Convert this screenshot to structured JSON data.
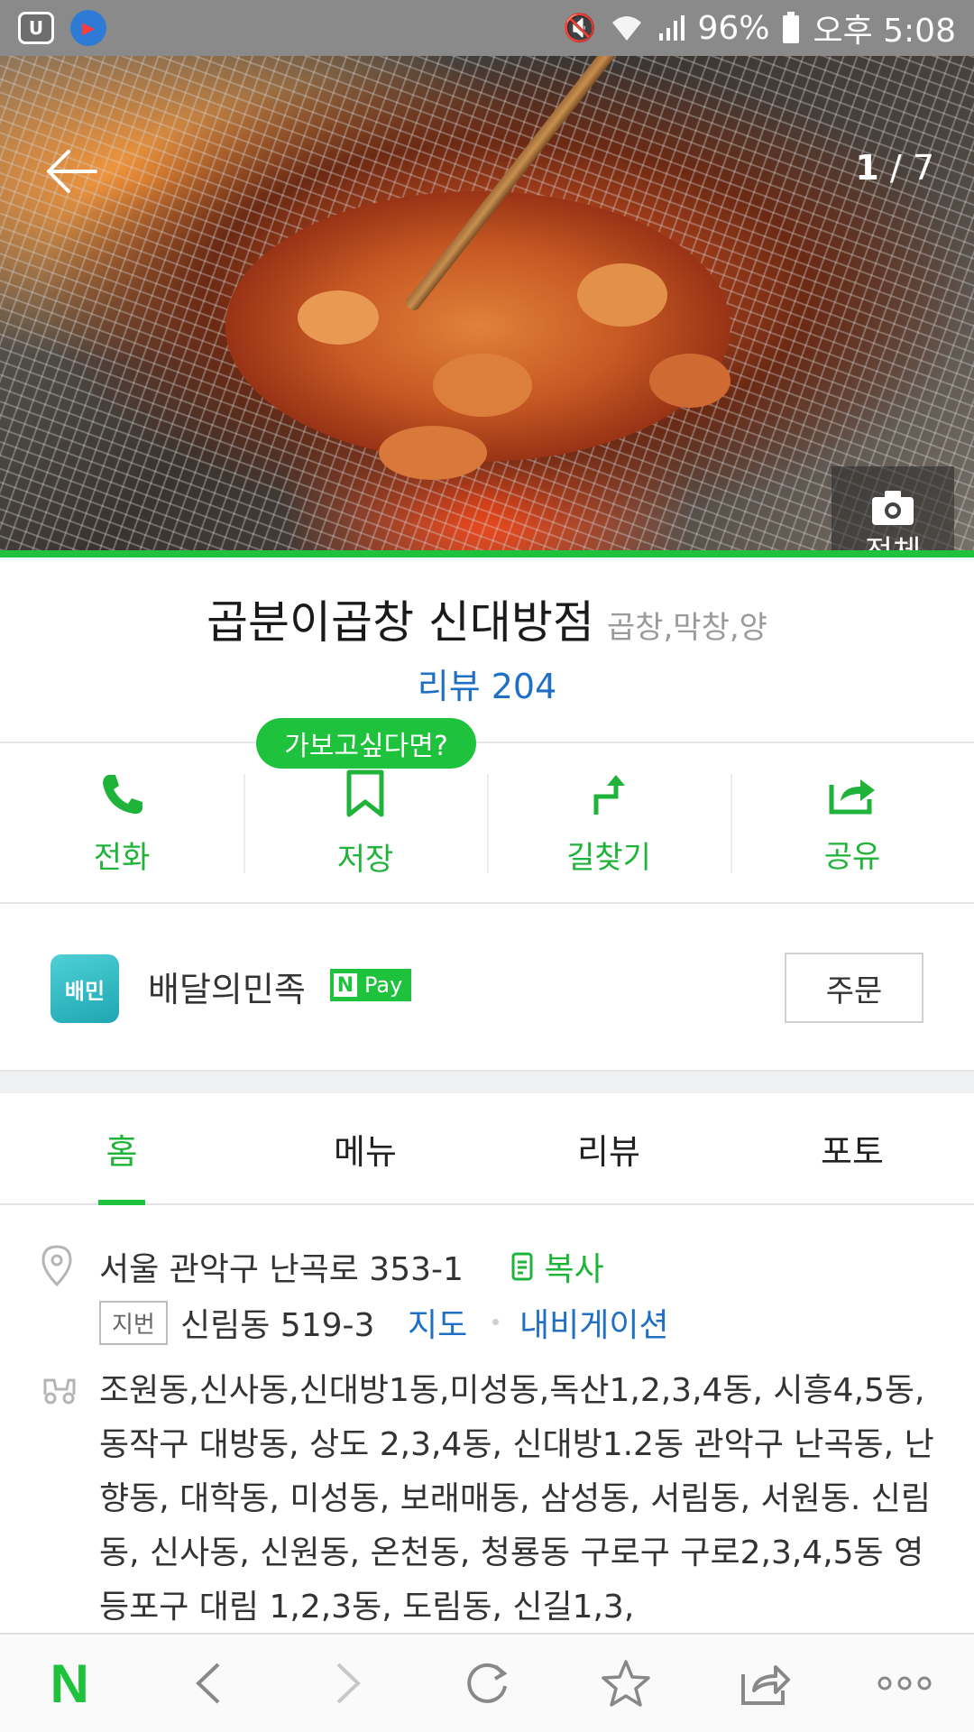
{
  "status_bar": {
    "battery": "96%",
    "time": "오후 5:08"
  },
  "hero": {
    "page_current": "1",
    "page_total": "7",
    "view_all_label": "전체"
  },
  "place": {
    "name": "곱분이곱창 신대방점",
    "category": "곱창,막창,양",
    "review_label": "리뷰 204"
  },
  "actions": {
    "tooltip": "가보고싶다면?",
    "call": "전화",
    "save": "저장",
    "directions": "길찾기",
    "share": "공유"
  },
  "delivery": {
    "service_name": "배달의민족",
    "pay_label": "Pay",
    "pay_n": "N",
    "order_label": "주문"
  },
  "tabs": {
    "home": "홈",
    "menu": "메뉴",
    "review": "리뷰",
    "photo": "포토"
  },
  "info": {
    "address": "서울 관악구 난곡로 353-1",
    "copy_label": "복사",
    "lot_badge": "지번",
    "lot_address": "신림동 519-3",
    "map_label": "지도",
    "navigation_label": "내비게이션",
    "delivery_area": "조원동,신사동,신대방1동,미성동,독산1,2,3,4동, 시흥4,5동, 동작구 대방동, 상도 2,3,4동, 신대방1.2동 관악구 난곡동, 난향동, 대학동, 미성동, 보래매동, 삼성동, 서림동, 서원동. 신림동, 신사동, 신원동, 온천동, 청룡동 구로구 구로2,3,4,5동 영등포구 대림 1,2,3동, 도림동, 신길1,3,"
  },
  "browser_bar": {
    "logo": "N"
  },
  "colors": {
    "accent_green": "#1fc23c",
    "link_blue": "#1f6fc4"
  }
}
